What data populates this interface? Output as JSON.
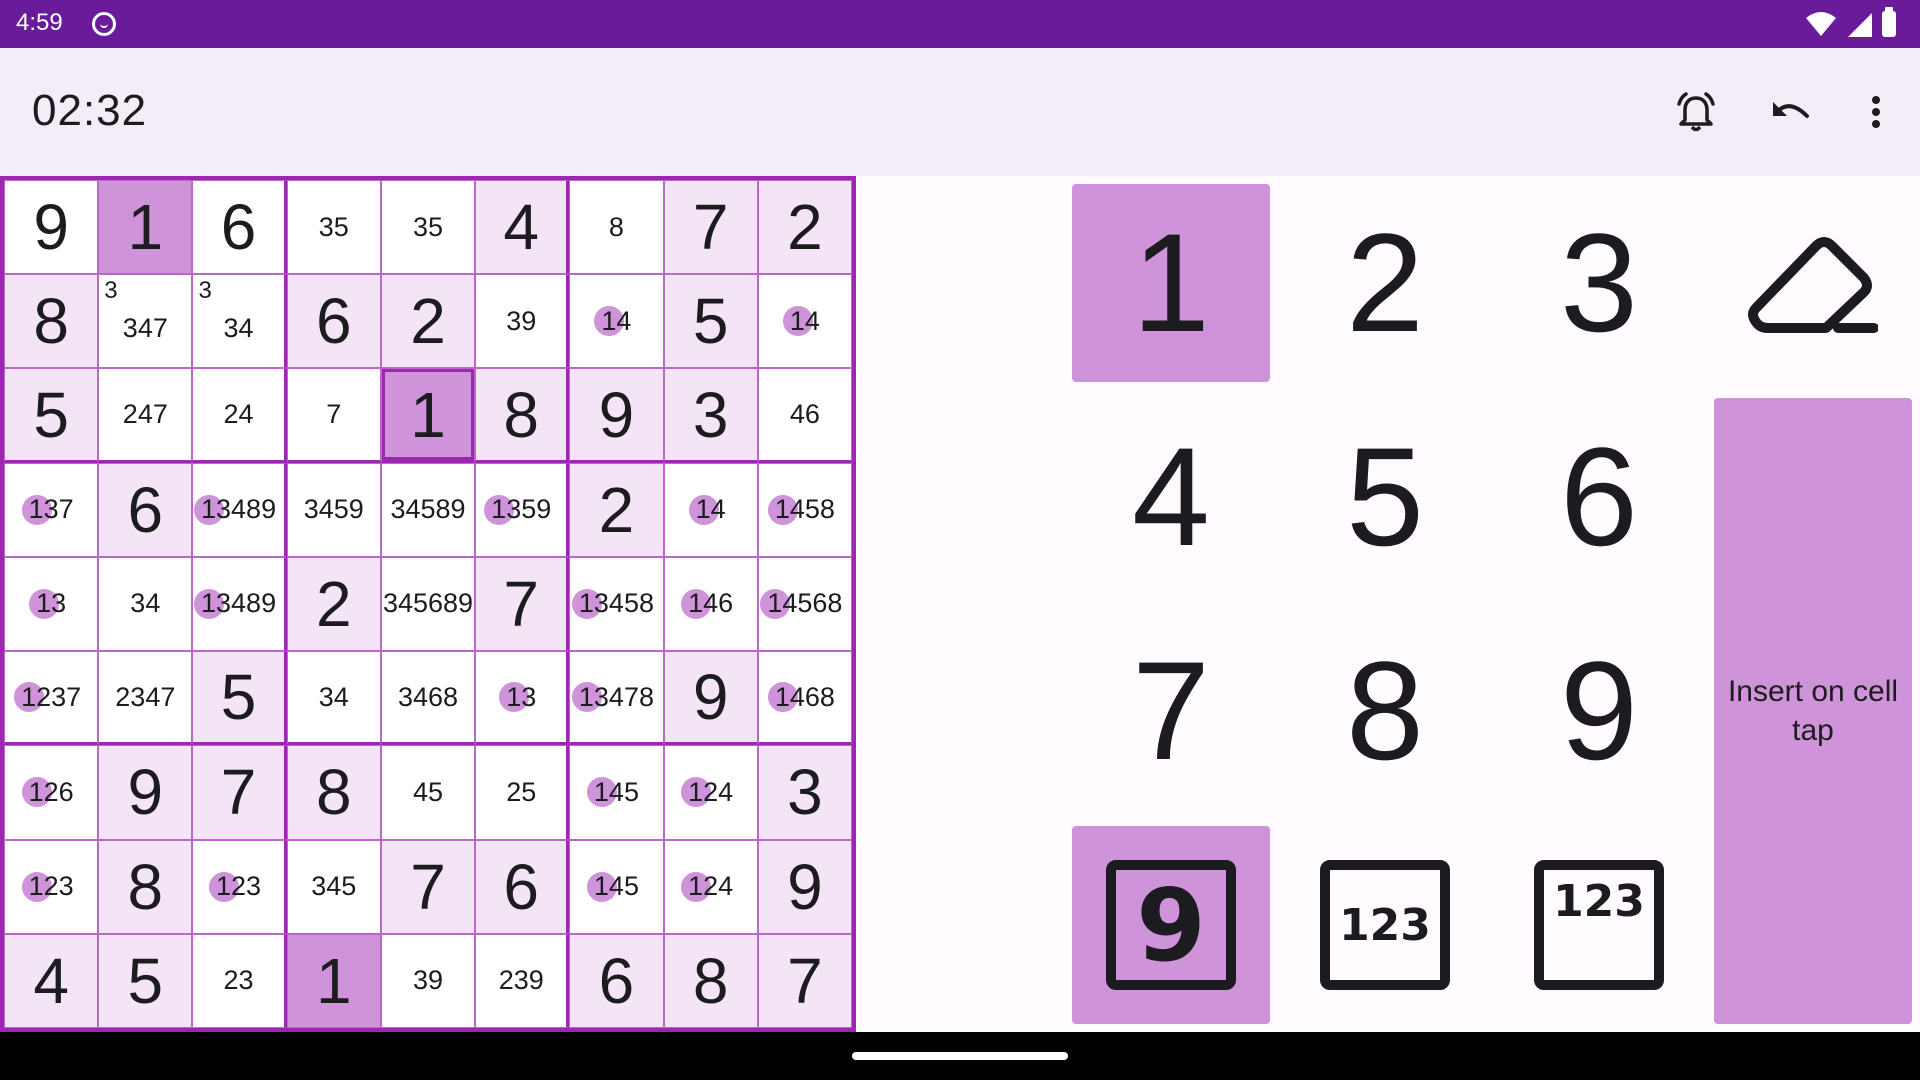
{
  "status_bar": {
    "time": "4:59"
  },
  "app_bar": {
    "timer": "02:32"
  },
  "board": {
    "cells": [
      [
        {
          "v": "9"
        },
        {
          "v": "1",
          "hl": "strong"
        },
        {
          "v": "6"
        },
        {
          "n": "35"
        },
        {
          "n": "35"
        },
        {
          "v": "4",
          "hl": "soft"
        },
        {
          "n": "8"
        },
        {
          "v": "7",
          "hl": "soft"
        },
        {
          "v": "2",
          "hl": "soft"
        }
      ],
      [
        {
          "v": "8",
          "hl": "soft"
        },
        {
          "c": "3",
          "n": "347"
        },
        {
          "c": "3",
          "n": "34"
        },
        {
          "v": "6",
          "hl": "soft"
        },
        {
          "v": "2",
          "hl": "soft"
        },
        {
          "n": "39"
        },
        {
          "n": "14",
          "dot": true
        },
        {
          "v": "5",
          "hl": "soft"
        },
        {
          "n": "14",
          "dot": true
        }
      ],
      [
        {
          "v": "5",
          "hl": "soft"
        },
        {
          "n": "247"
        },
        {
          "n": "24"
        },
        {
          "n": "7"
        },
        {
          "v": "1",
          "hl": "selected"
        },
        {
          "v": "8",
          "hl": "soft"
        },
        {
          "v": "9",
          "hl": "soft"
        },
        {
          "v": "3",
          "hl": "soft"
        },
        {
          "n": "46"
        }
      ],
      [
        {
          "n": "137",
          "dot": true
        },
        {
          "v": "6",
          "hl": "soft"
        },
        {
          "n": "13489",
          "dot": true
        },
        {
          "n": "3459"
        },
        {
          "n": "34589"
        },
        {
          "n": "1359",
          "dot": true
        },
        {
          "v": "2",
          "hl": "soft"
        },
        {
          "n": "14",
          "dot": true
        },
        {
          "n": "1458",
          "dot": true
        }
      ],
      [
        {
          "n": "13",
          "dot": true
        },
        {
          "n": "34"
        },
        {
          "n": "13489",
          "dot": true
        },
        {
          "v": "2",
          "hl": "soft"
        },
        {
          "n": "345689"
        },
        {
          "v": "7",
          "hl": "soft"
        },
        {
          "n": "13458",
          "dot": true
        },
        {
          "n": "146",
          "dot": true
        },
        {
          "n": "14568",
          "dot": true
        }
      ],
      [
        {
          "n": "1237",
          "dot": true
        },
        {
          "n": "2347"
        },
        {
          "v": "5",
          "hl": "soft"
        },
        {
          "n": "34"
        },
        {
          "n": "3468"
        },
        {
          "n": "13",
          "dot": true
        },
        {
          "n": "13478",
          "dot": true
        },
        {
          "v": "9",
          "hl": "soft"
        },
        {
          "n": "1468",
          "dot": true
        }
      ],
      [
        {
          "n": "126",
          "dot": true
        },
        {
          "v": "9",
          "hl": "soft"
        },
        {
          "v": "7",
          "hl": "soft"
        },
        {
          "v": "8",
          "hl": "soft"
        },
        {
          "n": "45"
        },
        {
          "n": "25"
        },
        {
          "n": "145",
          "dot": true
        },
        {
          "n": "124",
          "dot": true
        },
        {
          "v": "3",
          "hl": "soft"
        }
      ],
      [
        {
          "n": "123",
          "dot": true
        },
        {
          "v": "8",
          "hl": "soft"
        },
        {
          "n": "123",
          "dot": true
        },
        {
          "n": "345"
        },
        {
          "v": "7",
          "hl": "soft"
        },
        {
          "v": "6",
          "hl": "soft"
        },
        {
          "n": "145",
          "dot": true
        },
        {
          "n": "124",
          "dot": true
        },
        {
          "v": "9",
          "hl": "soft"
        }
      ],
      [
        {
          "v": "4",
          "hl": "soft"
        },
        {
          "v": "5",
          "hl": "soft"
        },
        {
          "n": "23"
        },
        {
          "v": "1",
          "hl": "strong"
        },
        {
          "n": "39"
        },
        {
          "n": "239"
        },
        {
          "v": "6",
          "hl": "soft"
        },
        {
          "v": "8",
          "hl": "soft"
        },
        {
          "v": "7",
          "hl": "soft"
        }
      ]
    ]
  },
  "keypad": {
    "digits": [
      "1",
      "2",
      "3",
      "4",
      "5",
      "6",
      "7",
      "8",
      "9"
    ],
    "active_digit": "1",
    "modes": {
      "value": "9",
      "center": "123",
      "corner": "123",
      "active": "value"
    },
    "insert_label": "Insert on cell tap"
  },
  "icons": {
    "alarm": "alarm-icon",
    "undo": "undo-icon",
    "more": "more-vert-icon",
    "eraser": "eraser-icon"
  },
  "colors": {
    "status_bar": "#6a1b9a",
    "app_bar": "#f3edf7",
    "accent": "#9c27b0",
    "highlight_strong": "#ce93d8",
    "highlight_soft": "#f3e5f5"
  }
}
